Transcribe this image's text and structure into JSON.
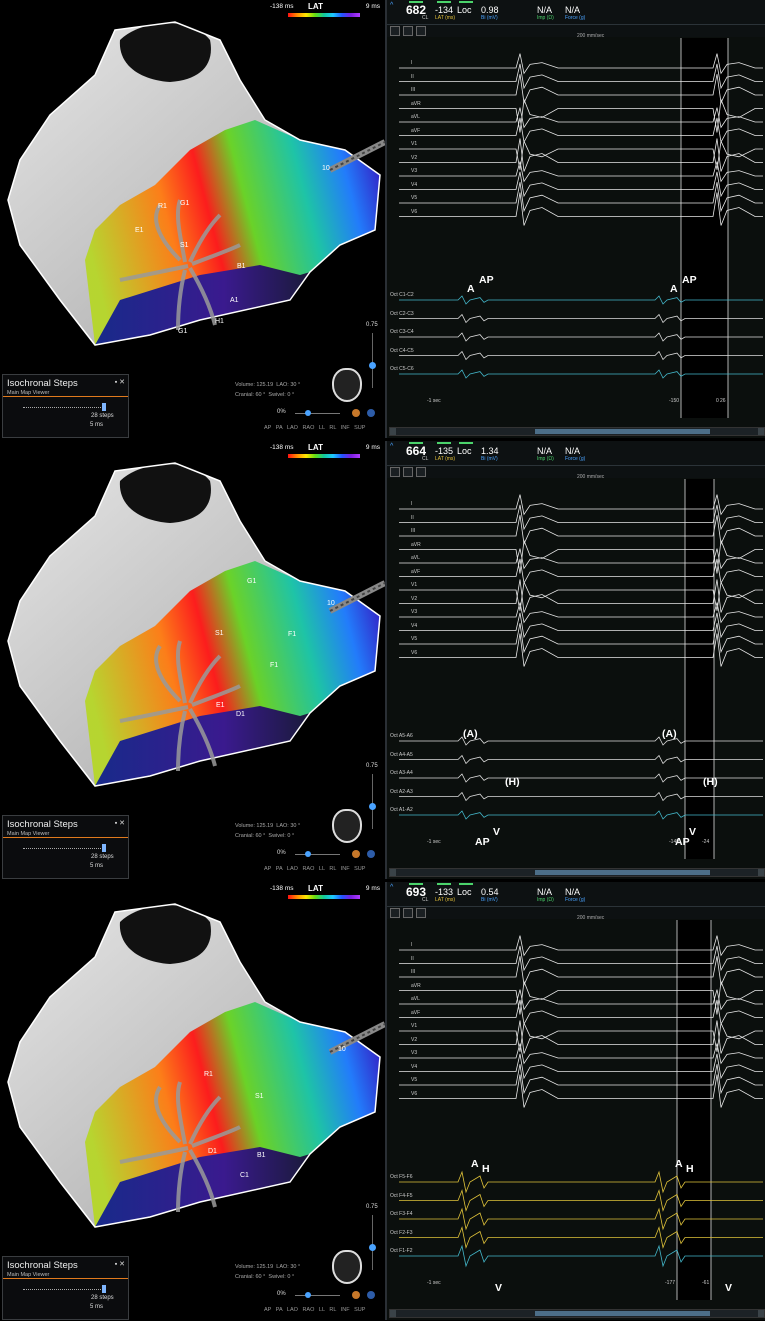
{
  "lat_legend": {
    "min": "-138 ms",
    "title": "LAT",
    "max": "9 ms"
  },
  "isochronal": {
    "title": "Isochronal Steps",
    "subtitle": "Main Map Viewer",
    "steps": "28 steps",
    "ms": "5 ms"
  },
  "view_info": {
    "volume_label": "Volume:",
    "volume": "125.19",
    "lao_label": "LAO:",
    "lao": "30 °",
    "cranial_label": "Cranial:",
    "cranial": "60 °",
    "swivel_label": "Swivel:",
    "swivel": "0 °"
  },
  "view_buttons": "AP PA LAO RAO LL RL INF SUP",
  "zoom": "0%",
  "vscale": "0.75",
  "speed": "200 mm/sec",
  "header_labels": {
    "cl": "CL",
    "lat": "LAT (ms)",
    "bi": "Bi (mV)",
    "imp": "Imp (Ω)",
    "force": "Force (g)",
    "loc": "Loc",
    "na": "N/A"
  },
  "surface_leads": [
    "I",
    "II",
    "III",
    "aVR",
    "aVL",
    "aVF",
    "V1",
    "V2",
    "V3",
    "V4",
    "V5",
    "V6"
  ],
  "panels": [
    {
      "cl": "682",
      "lat": "-134",
      "bi": "0.98",
      "bottom_left": "-1 sec",
      "markers": [
        "-150",
        "0",
        "26"
      ],
      "intracardiac": [
        "Oct C1-C2",
        "Oct C2-C3",
        "Oct C3-C4",
        "Oct C4-C5",
        "Oct C5-C6"
      ],
      "annotations": [
        "A",
        "AP",
        "A",
        "AP"
      ],
      "electrodes": [
        "R1",
        "G1",
        "E1",
        "S1",
        "B1",
        "A1",
        "H1",
        "G1",
        "10"
      ]
    },
    {
      "cl": "664",
      "lat": "-135",
      "bi": "1.34",
      "bottom_left": "-1 sec",
      "markers": [
        "-149",
        "0",
        "-24"
      ],
      "intracardiac": [
        "Oct A5-A6",
        "Oct A4-A5",
        "Oct A3-A4",
        "Oct A2-A3",
        "Oct A1-A2"
      ],
      "annotations": [
        "(A)",
        "(A)",
        "(H)",
        "(H)",
        "AP",
        "V",
        "AP",
        "V"
      ],
      "electrodes": [
        "G1",
        "S1",
        "F1",
        "F1",
        "E1",
        "D1",
        "10"
      ]
    },
    {
      "cl": "693",
      "lat": "-133",
      "bi": "0.54",
      "bottom_left": "-1 sec",
      "markers": [
        "-177",
        "-61"
      ],
      "intracardiac": [
        "Oct F5-F6",
        "Oct F4-F5",
        "Oct F3-F4",
        "Oct F2-F3",
        "Oct F1-F2"
      ],
      "annotations": [
        "A",
        "H",
        "A",
        "H",
        "V",
        "V"
      ],
      "electrodes": [
        "R1",
        "S1",
        "B1",
        "C1",
        "D1",
        "10"
      ]
    }
  ]
}
